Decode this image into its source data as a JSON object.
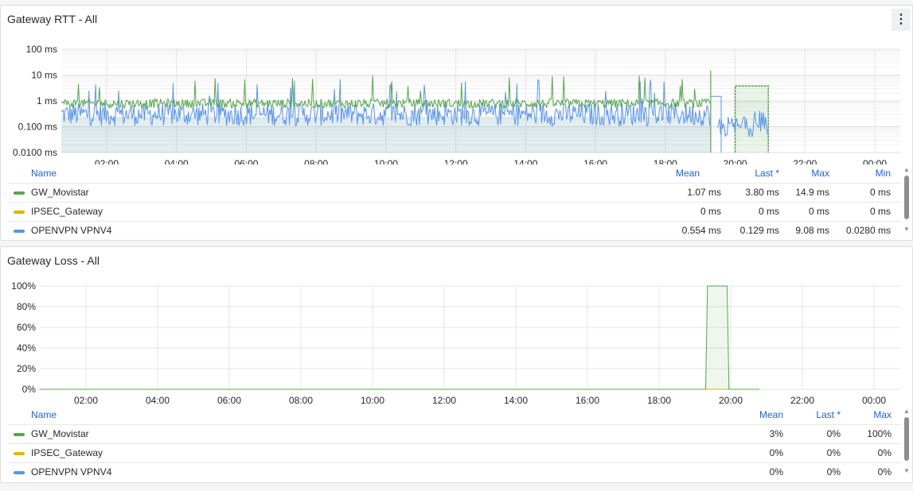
{
  "rtt_panel": {
    "title": "Gateway RTT - All",
    "menu_icon": "kebab-menu-icon",
    "legend": {
      "headers": {
        "name": "Name",
        "mean": "Mean",
        "last": "Last *",
        "max": "Max",
        "min": "Min"
      },
      "rows": [
        {
          "name": "GW_Movistar",
          "color": "#56a64b",
          "mean": "1.07 ms",
          "last": "3.80 ms",
          "max": "14.9 ms",
          "min": "0 ms"
        },
        {
          "name": "IPSEC_Gateway",
          "color": "#e0b400",
          "mean": "0 ms",
          "last": "0 ms",
          "max": "0 ms",
          "min": "0 ms"
        },
        {
          "name": "OPENVPN VPNV4",
          "color": "#5794f2",
          "mean": "0.554 ms",
          "last": "0.129 ms",
          "max": "9.08 ms",
          "min": "0.0280 ms"
        }
      ]
    }
  },
  "loss_panel": {
    "title": "Gateway Loss - All",
    "legend": {
      "headers": {
        "name": "Name",
        "mean": "Mean",
        "last": "Last *",
        "max": "Max"
      },
      "rows": [
        {
          "name": "GW_Movistar",
          "color": "#56a64b",
          "mean": "3%",
          "last": "0%",
          "max": "100%"
        },
        {
          "name": "IPSEC_Gateway",
          "color": "#e0b400",
          "mean": "0%",
          "last": "0%",
          "max": "0%"
        },
        {
          "name": "OPENVPN VPNV4",
          "color": "#5794f2",
          "mean": "0%",
          "last": "0%",
          "max": "0%"
        }
      ]
    }
  },
  "chart_data": [
    {
      "type": "line",
      "title": "Gateway RTT - All",
      "y_scale": "log",
      "y_ticks": [
        "100 ms",
        "10 ms",
        "1 ms",
        "0.100 ms",
        "0.0100 ms"
      ],
      "x_ticks": [
        "02:00",
        "04:00",
        "06:00",
        "08:00",
        "10:00",
        "12:00",
        "14:00",
        "16:00",
        "18:00",
        "20:00",
        "22:00",
        "00:00"
      ],
      "ylim": [
        0.01,
        100
      ],
      "x_range_hours": [
        0.7,
        24.8
      ],
      "grid": true,
      "series": [
        {
          "name": "GW_Movistar",
          "color": "#56a64b",
          "typical_ms": 0.8,
          "spike_ms": 8,
          "active_hours": [
            0.7,
            19.3
          ],
          "level_after": {
            "from_hours": 20.0,
            "to_hours": 20.95,
            "value_ms": 3.8
          }
        },
        {
          "name": "IPSEC_Gateway",
          "color": "#e0b400",
          "value_ms": 0
        },
        {
          "name": "OPENVPN VPNV4",
          "color": "#5794f2",
          "typical_ms": 0.3,
          "active_hours": [
            0.7,
            19.3
          ],
          "level_after": {
            "from_hours": 19.5,
            "to_hours": 20.95,
            "value_ms": 0.1
          }
        }
      ]
    },
    {
      "type": "line",
      "title": "Gateway Loss - All",
      "y_ticks": [
        "100%",
        "80%",
        "60%",
        "40%",
        "20%",
        "0%"
      ],
      "x_ticks": [
        "02:00",
        "04:00",
        "06:00",
        "08:00",
        "10:00",
        "12:00",
        "14:00",
        "16:00",
        "18:00",
        "20:00",
        "22:00",
        "00:00"
      ],
      "ylim": [
        0,
        100
      ],
      "grid": true,
      "series": [
        {
          "name": "GW_Movistar",
          "color": "#56a64b",
          "points": [
            [
              0.7,
              0
            ],
            [
              19.3,
              0
            ],
            [
              19.35,
              100
            ],
            [
              19.9,
              100
            ],
            [
              19.95,
              0
            ],
            [
              20.8,
              0
            ]
          ]
        },
        {
          "name": "IPSEC_Gateway",
          "color": "#e0b400",
          "points": [
            [
              0.7,
              0
            ],
            [
              20.8,
              0
            ]
          ]
        },
        {
          "name": "OPENVPN VPNV4",
          "color": "#5794f2",
          "points": [
            [
              0.7,
              0
            ],
            [
              20.8,
              0
            ]
          ]
        }
      ]
    }
  ]
}
